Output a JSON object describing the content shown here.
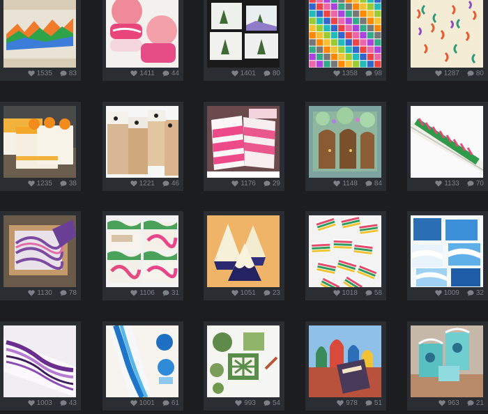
{
  "posts": [
    {
      "likes": "1535",
      "comments": "83",
      "art": "swirl-loaf"
    },
    {
      "likes": "1411",
      "comments": "44",
      "art": "pink-rounds"
    },
    {
      "likes": "1401",
      "comments": "80",
      "art": "tree-bars"
    },
    {
      "likes": "1358",
      "comments": "98",
      "art": "sample-grid"
    },
    {
      "likes": "1287",
      "comments": "80",
      "art": "confetti-loaf"
    },
    {
      "likes": "1235",
      "comments": "38",
      "art": "citrus-stack"
    },
    {
      "likes": "1221",
      "comments": "46",
      "art": "face-bars"
    },
    {
      "likes": "1176",
      "comments": "29",
      "art": "pink-stripes"
    },
    {
      "likes": "1148",
      "comments": "84",
      "art": "fairy-door"
    },
    {
      "likes": "1133",
      "comments": "70",
      "art": "feather-loaf"
    },
    {
      "likes": "1130",
      "comments": "78",
      "art": "mold-swirl"
    },
    {
      "likes": "1106",
      "comments": "31",
      "art": "labeled-bars"
    },
    {
      "likes": "1051",
      "comments": "23",
      "art": "mountain-pyramids"
    },
    {
      "likes": "1018",
      "comments": "58",
      "art": "stripe-slices"
    },
    {
      "likes": "1009",
      "comments": "32",
      "art": "blue-waves"
    },
    {
      "likes": "1003",
      "comments": "43",
      "art": "purple-marble"
    },
    {
      "likes": "1001",
      "comments": "61",
      "art": "blue-loaf"
    },
    {
      "likes": "993",
      "comments": "54",
      "art": "celtic-stamps"
    },
    {
      "likes": "978",
      "comments": "51",
      "art": "cathedral-book"
    },
    {
      "likes": "963",
      "comments": "21",
      "art": "teal-houses"
    }
  ],
  "icons": {
    "likes": "heart-icon",
    "comments": "comment-bubble-icon"
  },
  "colors": {
    "background": "#1b1d20",
    "card": "#2a2e33",
    "meta_text": "#7c8188"
  }
}
